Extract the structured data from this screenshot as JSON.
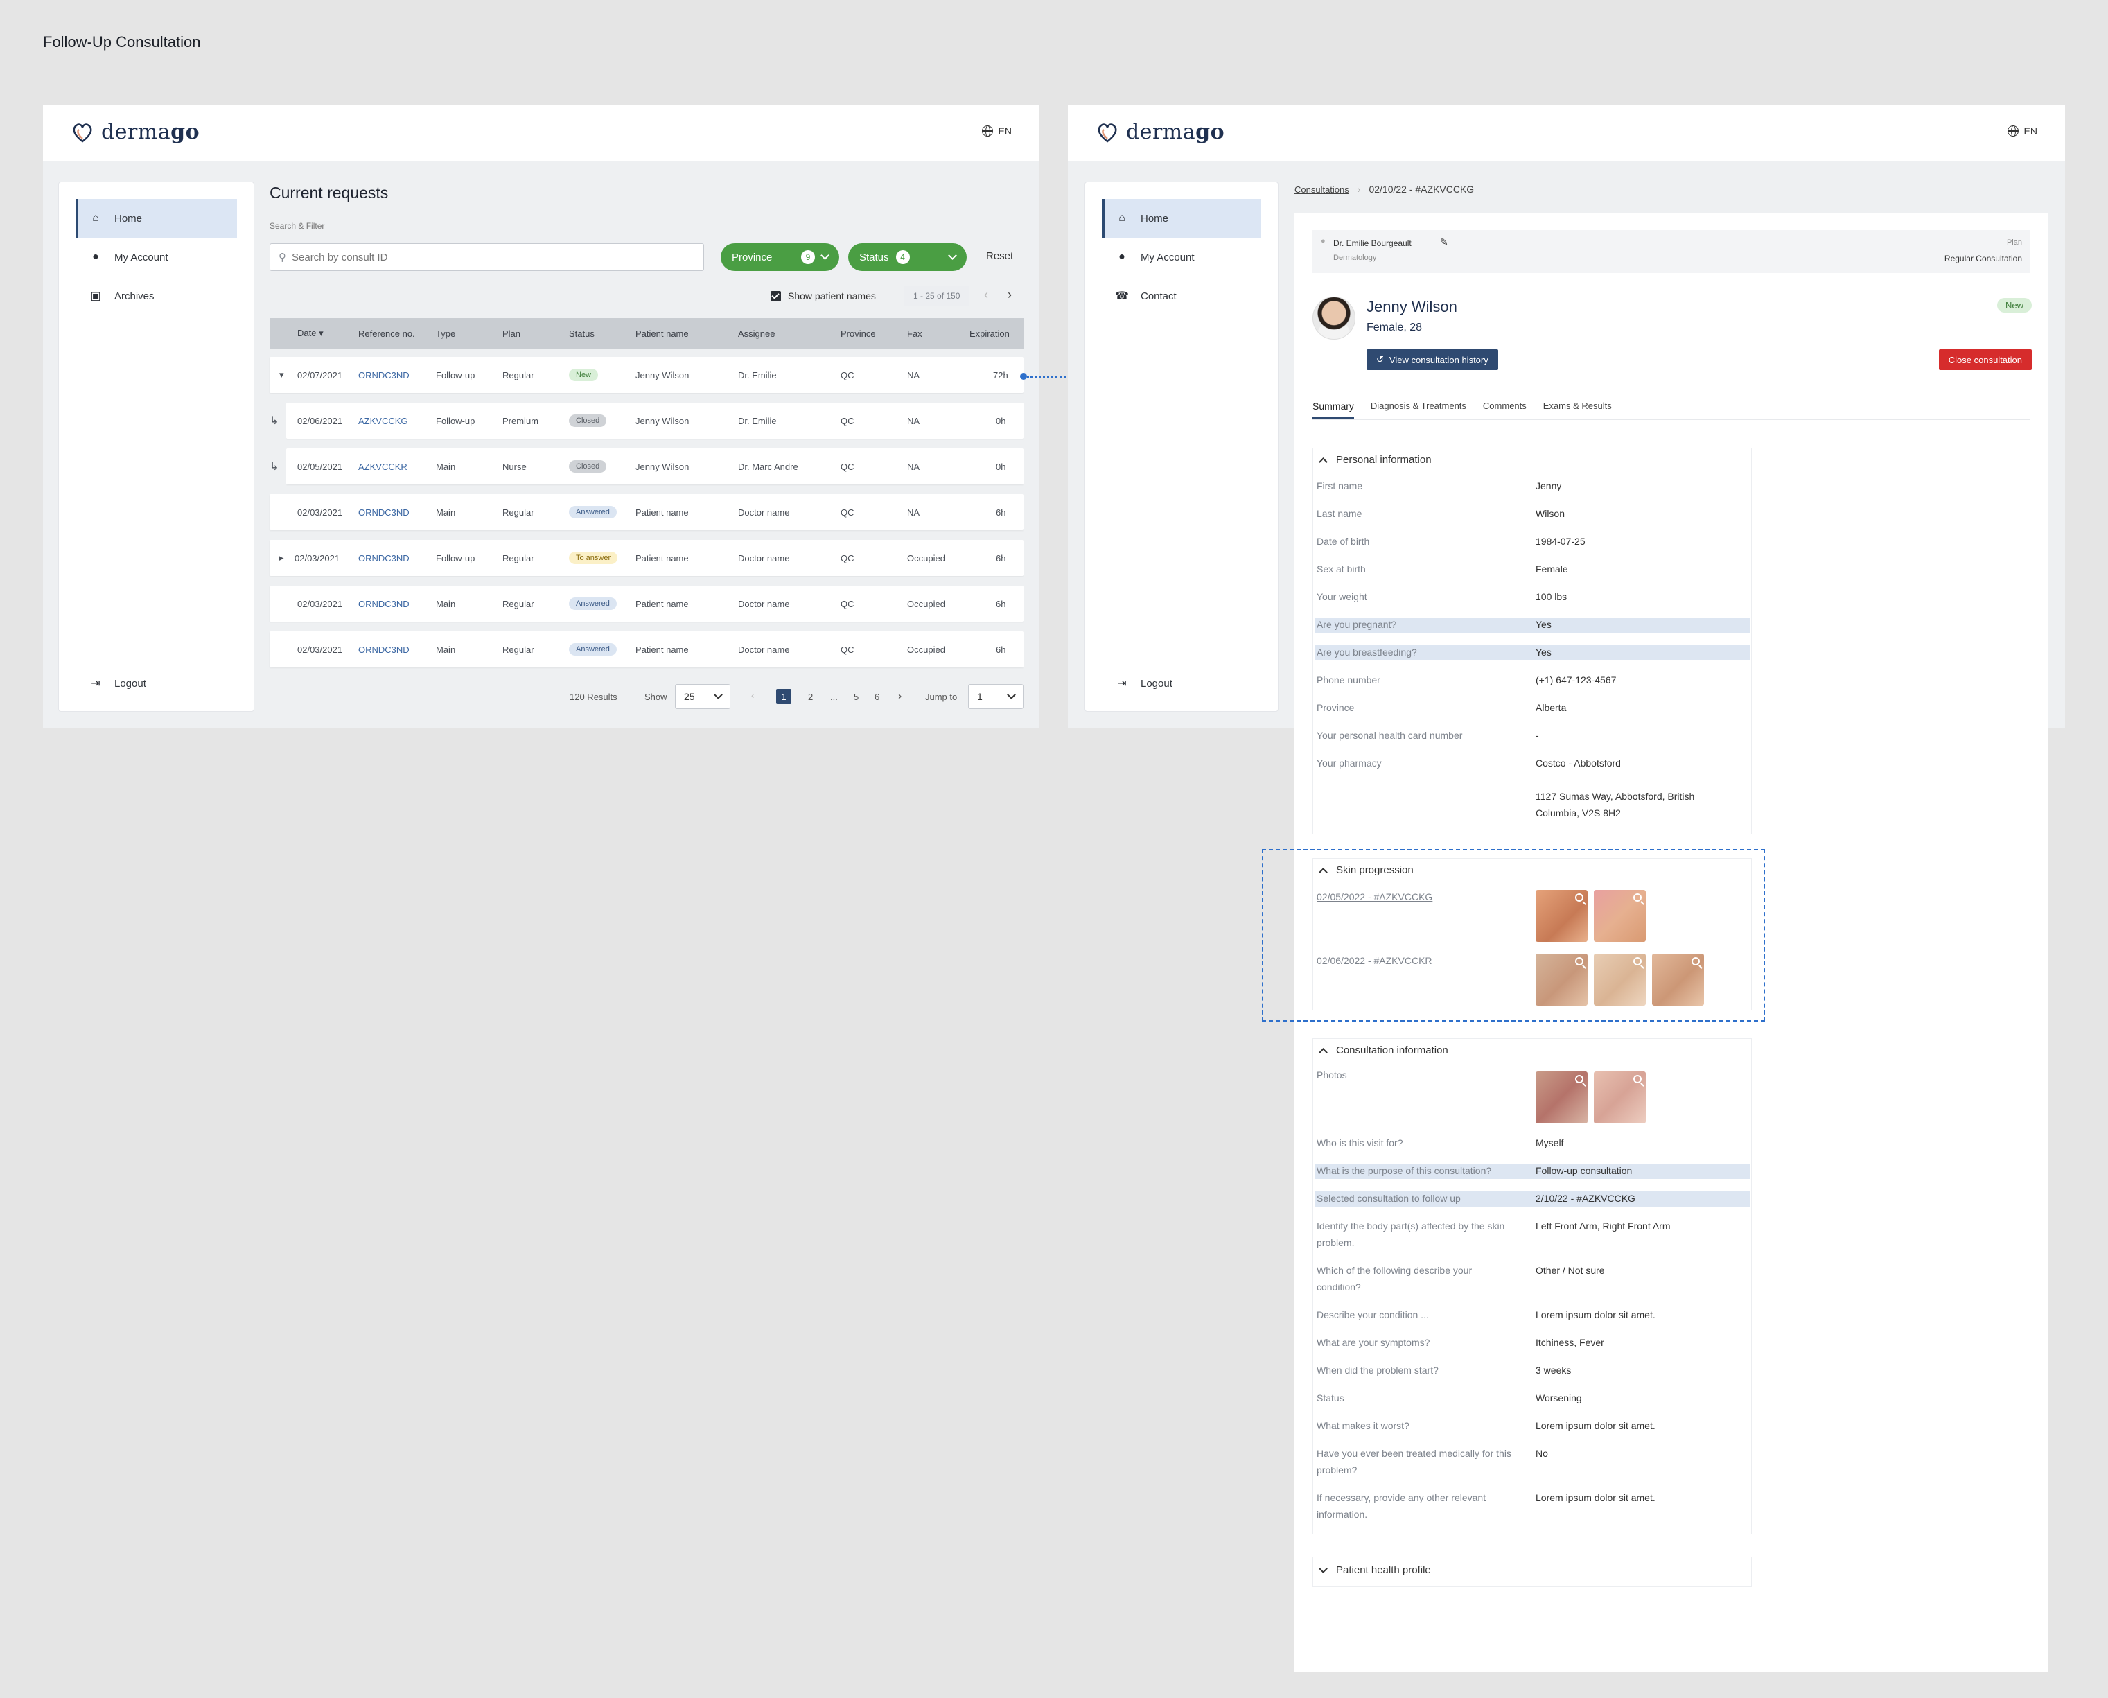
{
  "page_title": "Follow-Up Consultation",
  "brand": {
    "name_a": "derma",
    "name_b": "go"
  },
  "lang": "EN",
  "left_screen": {
    "nav": [
      {
        "label": "Home",
        "icon": "home-icon"
      },
      {
        "label": "My Account",
        "icon": "user-icon"
      },
      {
        "label": "Archives",
        "icon": "archive-icon"
      }
    ],
    "logout": "Logout",
    "heading": "Current requests",
    "filter_label": "Search & Filter",
    "search_placeholder": "Search by consult ID",
    "province_pill": {
      "label": "Province",
      "count": "9"
    },
    "status_pill": {
      "label": "Status",
      "count": "4"
    },
    "reset": "Reset",
    "show_names": "Show patient names",
    "range": "1 - 25 of 150",
    "columns": [
      "Date",
      "Reference no.",
      "Type",
      "Plan",
      "Status",
      "Patient name",
      "Assignee",
      "Province",
      "Fax",
      "Expiration"
    ],
    "rows": [
      {
        "date": "02/07/2021",
        "ref": "ORNDC3ND",
        "type": "Follow-up",
        "plan": "Regular",
        "status": "New",
        "patient": "Jenny Wilson",
        "assignee": "Dr. Emilie",
        "province": "QC",
        "fax": "NA",
        "exp": "72h"
      },
      {
        "date": "02/06/2021",
        "ref": "AZKVCCKG",
        "type": "Follow-up",
        "plan": "Premium",
        "status": "Closed",
        "patient": "Jenny Wilson",
        "assignee": "Dr. Emilie",
        "province": "QC",
        "fax": "NA",
        "exp": "0h"
      },
      {
        "date": "02/05/2021",
        "ref": "AZKVCCKR",
        "type": "Main",
        "plan": "Nurse",
        "status": "Closed",
        "patient": "Jenny Wilson",
        "assignee": "Dr. Marc Andre",
        "province": "QC",
        "fax": "NA",
        "exp": "0h"
      },
      {
        "date": "02/03/2021",
        "ref": "ORNDC3ND",
        "type": "Main",
        "plan": "Regular",
        "status": "Answered",
        "patient": "Patient name",
        "assignee": "Doctor name",
        "province": "QC",
        "fax": "NA",
        "exp": "6h"
      },
      {
        "date": "02/03/2021",
        "ref": "ORNDC3ND",
        "type": "Follow-up",
        "plan": "Regular",
        "status": "To answer",
        "patient": "Patient name",
        "assignee": "Doctor name",
        "province": "QC",
        "fax": "Occupied",
        "exp": "6h"
      },
      {
        "date": "02/03/2021",
        "ref": "ORNDC3ND",
        "type": "Main",
        "plan": "Regular",
        "status": "Answered",
        "patient": "Patient name",
        "assignee": "Doctor name",
        "province": "QC",
        "fax": "Occupied",
        "exp": "6h"
      },
      {
        "date": "02/03/2021",
        "ref": "ORNDC3ND",
        "type": "Main",
        "plan": "Regular",
        "status": "Answered",
        "patient": "Patient name",
        "assignee": "Doctor name",
        "province": "QC",
        "fax": "Occupied",
        "exp": "6h"
      }
    ],
    "results": "120 Results",
    "show_label": "Show",
    "show_value": "25",
    "pages": [
      "1",
      "2",
      "...",
      "5",
      "6"
    ],
    "jump_label": "Jump to",
    "jump_value": "1"
  },
  "right_screen": {
    "nav": [
      {
        "label": "Home",
        "icon": "home-icon"
      },
      {
        "label": "My Account",
        "icon": "user-icon"
      },
      {
        "label": "Contact",
        "icon": "phone-icon"
      }
    ],
    "logout": "Logout",
    "breadcrumb_root": "Consultations",
    "breadcrumb_current": "02/10/22 - #AZKVCCKG",
    "doctor": "Dr. Emilie Bourgeault",
    "specialty": "Dermatology",
    "plan_label": "Plan",
    "plan_value": "Regular Consultation",
    "patient_name": "Jenny Wilson",
    "patient_meta": "Female, 28",
    "status_badge": "New",
    "history_button": "View consultation history",
    "close_button": "Close consultation",
    "tabs": [
      "Summary",
      "Diagnosis & Treatments",
      "Comments",
      "Exams & Results"
    ],
    "personal": {
      "title": "Personal information",
      "rows": [
        {
          "label": "First name",
          "value": "Jenny"
        },
        {
          "label": "Last name",
          "value": "Wilson"
        },
        {
          "label": "Date of birth",
          "value": "1984-07-25"
        },
        {
          "label": "Sex at birth",
          "value": "Female"
        },
        {
          "label": "Your weight",
          "value": "100 lbs"
        },
        {
          "label": "Are you pregnant?",
          "value": "Yes"
        },
        {
          "label": "Are you breastfeeding?",
          "value": "Yes"
        },
        {
          "label": "Phone number",
          "value": "(+1) 647-123-4567"
        },
        {
          "label": "Province",
          "value": "Alberta"
        },
        {
          "label": "Your personal health card number",
          "value": "-"
        },
        {
          "label": "Your pharmacy",
          "value": "Costco - Abbotsford"
        }
      ],
      "address_1": "1127 Sumas Way, Abbotsford, British",
      "address_2": "Columbia, V2S 8H2"
    },
    "skin": {
      "title": "Skin progression",
      "entries": [
        "02/05/2022 - #AZKVCCKG",
        "02/06/2022 - #AZKVCCKR"
      ]
    },
    "consultation": {
      "title": "Consultation information",
      "photos_label": "Photos",
      "rows": [
        {
          "label": "Who is this visit for?",
          "value": "Myself"
        },
        {
          "label": "What is the purpose of this consultation?",
          "value": "Follow-up consultation"
        },
        {
          "label": "Selected consultation to follow up",
          "value": "2/10/22 - #AZKVCCKG"
        },
        {
          "label": "Identify the body part(s) affected by the skin",
          "label2": "problem.",
          "value": "Left Front Arm, Right Front Arm"
        },
        {
          "label": "Which of the following describe your",
          "label2": "condition?",
          "value": "Other / Not sure"
        },
        {
          "label": "Describe your condition ...",
          "value": "Lorem ipsum dolor sit amet."
        },
        {
          "label": "What are your symptoms?",
          "value": "Itchiness, Fever"
        },
        {
          "label": "When did the problem start?",
          "value": "3 weeks"
        },
        {
          "label": "Status",
          "value": "Worsening"
        },
        {
          "label": "What makes it worst?",
          "value": "Lorem ipsum dolor sit amet."
        },
        {
          "label": "Have you ever been treated medically for this",
          "label2": "problem?",
          "value": "No"
        },
        {
          "label": "If necessary, provide any other relevant",
          "label2": "information.",
          "value": "Lorem ipsum dolor sit amet."
        }
      ]
    },
    "health_profile": "Patient health profile"
  }
}
